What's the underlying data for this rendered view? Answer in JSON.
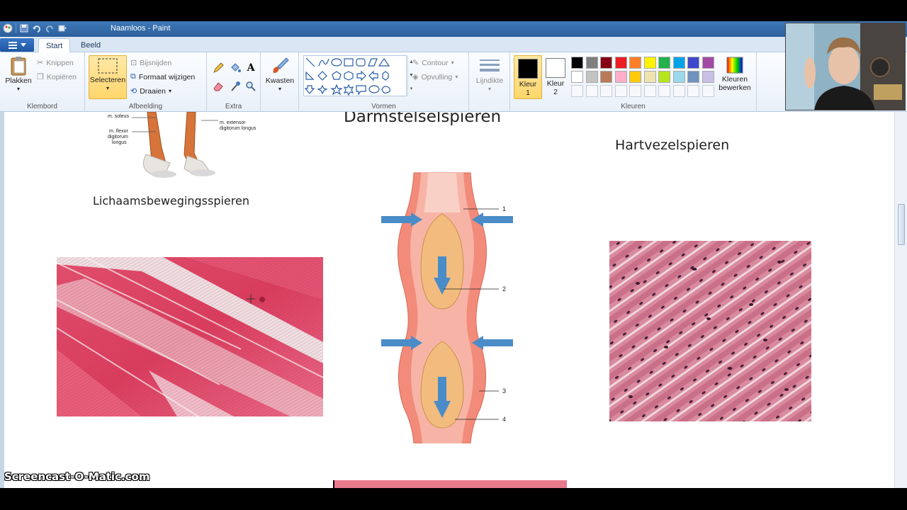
{
  "window": {
    "title": "Naamloos - Paint"
  },
  "ribbon": {
    "tabs": [
      "Start",
      "Beeld"
    ],
    "groups": {
      "klembord": {
        "label": "Klembord",
        "paste": "Plakken",
        "cut": "Knippen",
        "copy": "Kopiëren"
      },
      "afbeelding": {
        "label": "Afbeelding",
        "select": "Selecteren",
        "crop": "Bijsnijden",
        "resize": "Formaat wijzigen",
        "rotate": "Draaien"
      },
      "extra": {
        "label": "Extra"
      },
      "kwasten": {
        "label": "Kwasten"
      },
      "vormen": {
        "label": "Vormen",
        "outline": "Contour",
        "fill": "Opvulling"
      },
      "lijndikte": {
        "label": "Lijndikte"
      },
      "kleuren": {
        "label": "Kleuren",
        "color1": "Kleur 1",
        "color2": "Kleur 2",
        "edit": "Kleuren bewerken",
        "palette_row1": [
          "#000000",
          "#7f7f7f",
          "#880015",
          "#ed1c24",
          "#ff7f27",
          "#fff200",
          "#22b14c",
          "#00a2e8",
          "#3f48cc",
          "#a349a4"
        ],
        "palette_row2": [
          "#ffffff",
          "#c3c3c3",
          "#b97a57",
          "#ffaec9",
          "#ffc90e",
          "#efe4b0",
          "#b5e61d",
          "#99d9ea",
          "#7092be",
          "#c8bfe7"
        ]
      }
    }
  },
  "canvas": {
    "title_intestine": "Darmstelselspieren",
    "title_heart": "Hartvezelspieren",
    "title_skeletal": "Lichaamsbewegingsspieren",
    "leg_labels": [
      "m. soleus",
      "m. flexor",
      "digitorum",
      "longus",
      "m. extensor",
      "digitorum longus"
    ],
    "diagram_labels": [
      "1",
      "2",
      "3",
      "4"
    ]
  },
  "watermark": "Screencast-O-Matic.com"
}
